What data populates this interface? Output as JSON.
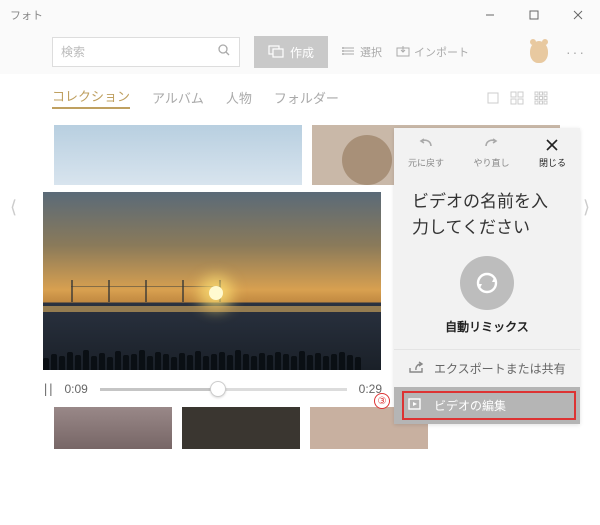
{
  "titlebar": {
    "title": "フォト"
  },
  "toolbar": {
    "search_placeholder": "検索",
    "create": "作成",
    "select": "選択",
    "import": "インポート"
  },
  "tabs": {
    "collection": "コレクション",
    "album": "アルバム",
    "people": "人物",
    "folder": "フォルダー"
  },
  "player": {
    "current": "0:09",
    "duration": "0:29"
  },
  "panel": {
    "undo": "元に戻す",
    "redo": "やり直し",
    "close": "閉じる",
    "title_line1": "ビデオの名前を入",
    "title_line2": "力してください",
    "remix": "自動リミックス",
    "export": "エクスポートまたは共有",
    "edit": "ビデオの編集",
    "callout": "③"
  }
}
